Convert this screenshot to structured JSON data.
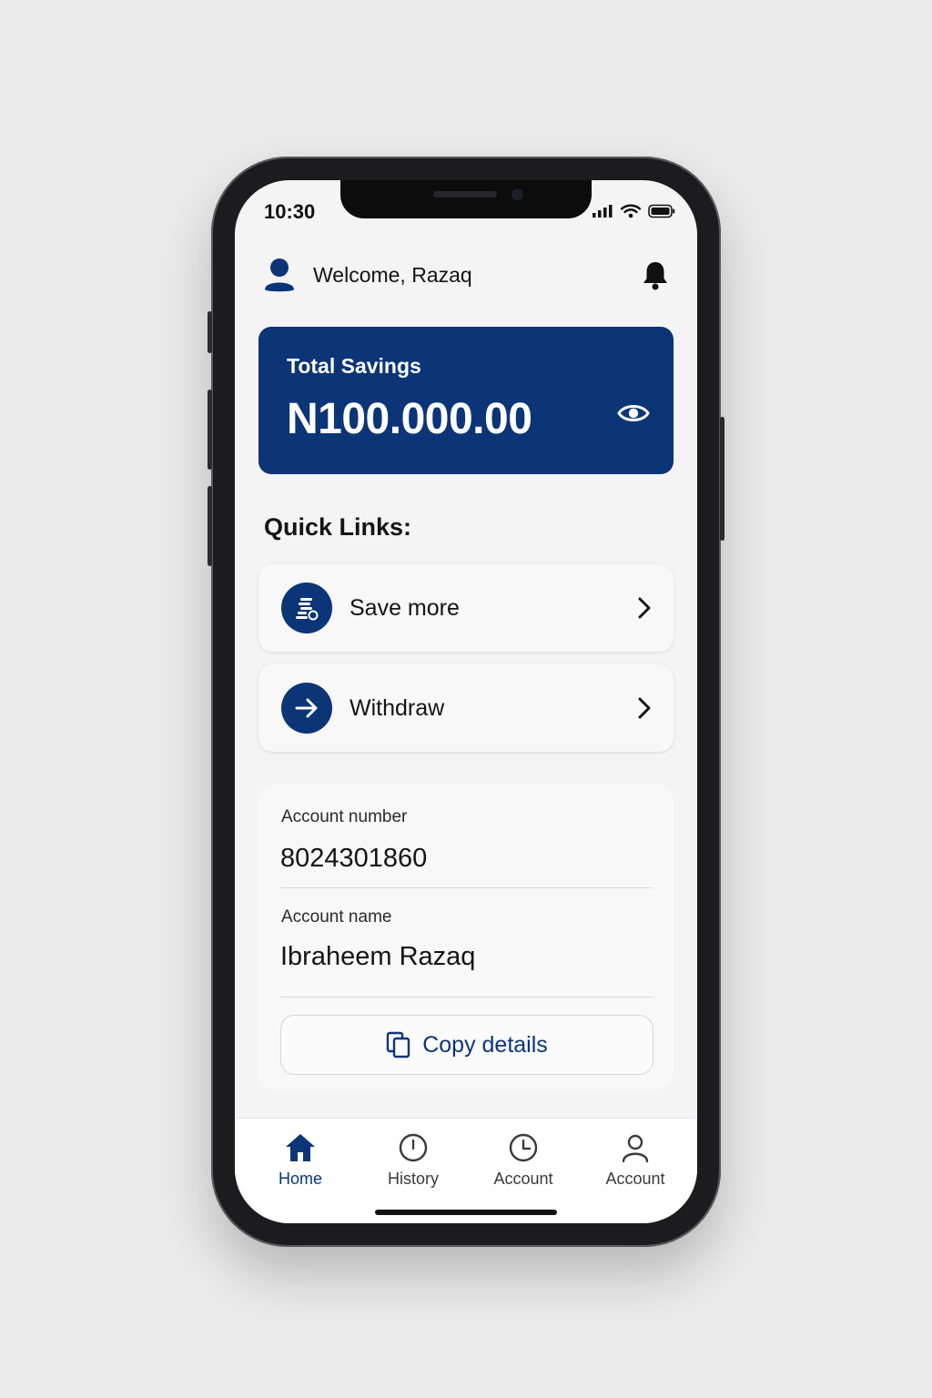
{
  "status_bar": {
    "time": "10:30"
  },
  "header": {
    "welcome_text": "Welcome, Razaq"
  },
  "savings": {
    "label": "Total Savings",
    "amount": "N100.000.00"
  },
  "quick_links": {
    "title": "Quick Links:",
    "items": [
      {
        "label": "Save more",
        "icon": "coins-icon"
      },
      {
        "label": "Withdraw",
        "icon": "arrow-right-icon"
      }
    ]
  },
  "account": {
    "number_label": "Account number",
    "number_value": "8024301860",
    "name_label": "Account name",
    "name_value": "Ibraheem Razaq",
    "copy_label": "Copy details"
  },
  "bottom_nav": {
    "items": [
      {
        "label": "Home",
        "icon": "home-icon",
        "active": true
      },
      {
        "label": "History",
        "icon": "clock-icon",
        "active": false
      },
      {
        "label": "Account",
        "icon": "clock-icon",
        "active": false
      },
      {
        "label": "Account",
        "icon": "user-icon",
        "active": false
      }
    ]
  },
  "colors": {
    "brand": "#0c3577",
    "background": "#f4f4f5"
  }
}
